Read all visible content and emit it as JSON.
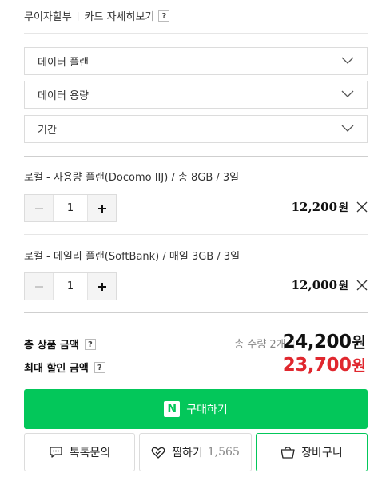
{
  "top": {
    "interest_free": "무이자할부",
    "card_detail": "카드 자세히보기",
    "help": "?"
  },
  "selects": [
    {
      "label": "데이터 플랜"
    },
    {
      "label": "데이터 용량"
    },
    {
      "label": "기간"
    }
  ],
  "items": [
    {
      "name": "로컬 - 사용량 플랜(Docomo IIJ) / 총 8GB / 3일",
      "qty": "1",
      "price": "12,200",
      "won": "원"
    },
    {
      "name": "로컬 - 데일리 플랜(SoftBank) / 매일 3GB / 3일",
      "qty": "1",
      "price": "12,000",
      "won": "원"
    }
  ],
  "totals": {
    "total_label": "총 상품 금액",
    "discount_label": "최대 할인 금액",
    "help": "?",
    "qty_summary": "총 수량 2개",
    "total_amount": "24,200",
    "discount_amount": "23,700",
    "won": "원",
    "total_color": "#111111",
    "discount_color": "#e0272e"
  },
  "actions": {
    "buy_logo": "N",
    "buy_label": "구매하기",
    "talk_label": "톡톡문의",
    "wish_label": "찜하기",
    "wish_count": "1,565",
    "cart_label": "장바구니",
    "accent": "#03c75a"
  },
  "icons": {
    "chevron": "chevron-down-icon",
    "minus": "minus-icon",
    "plus": "plus-icon",
    "remove": "close-icon",
    "talk": "chat-bubble-icon",
    "wish": "heart-check-icon",
    "cart": "shopping-bag-icon"
  }
}
